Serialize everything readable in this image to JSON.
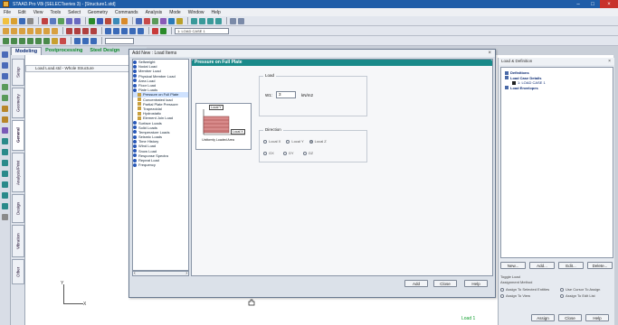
{
  "title_bar": {
    "text": "STAAD.Pro V8i (SELECTseries 3) - [Structure1.std]",
    "controls": [
      "–",
      "□",
      "×"
    ]
  },
  "menu": [
    "File",
    "Edit",
    "View",
    "Tools",
    "Select",
    "Geometry",
    "Commands",
    "Analysis",
    "Mode",
    "Window",
    "Help"
  ],
  "toolbar": {
    "combo1": "1: LOAD CASE 1",
    "combo2": ""
  },
  "page_tabs": {
    "modeling": "Modeling",
    "postprocessing": "Postprocessing",
    "steel_design": "Steel Design"
  },
  "side_tabs": [
    "Setup",
    "Geometry",
    "General",
    "Analysis/Print",
    "Design",
    "Vibration",
    "Other"
  ],
  "view_title": "Load Load.std - Whole Structure",
  "dialog": {
    "title": "Add New : Load Items",
    "panel_header": "Pressure on Full Plate",
    "tree": [
      {
        "label": "Selfweight",
        "kind": "load"
      },
      {
        "label": "Nodal Load",
        "kind": "load"
      },
      {
        "label": "Member Load",
        "kind": "load"
      },
      {
        "label": "Physical Member Load",
        "kind": "load"
      },
      {
        "label": "Area Load",
        "kind": "load"
      },
      {
        "label": "Floor Load",
        "kind": "load"
      },
      {
        "label": "Plate Loads",
        "kind": "load"
      },
      {
        "label": "Pressure on Full Plate",
        "kind": "sub",
        "selected": true
      },
      {
        "label": "Concentrated load",
        "kind": "sub"
      },
      {
        "label": "Partial Plate Pressure",
        "kind": "sub"
      },
      {
        "label": "Trapezoidal",
        "kind": "sub"
      },
      {
        "label": "Hydrostatic",
        "kind": "sub"
      },
      {
        "label": "Element Join Load",
        "kind": "sub"
      },
      {
        "label": "Surface Loads",
        "kind": "load"
      },
      {
        "label": "Solid Loads",
        "kind": "load"
      },
      {
        "label": "Temperature Loads",
        "kind": "load"
      },
      {
        "label": "Seismic Loads",
        "kind": "load"
      },
      {
        "label": "Time History",
        "kind": "load"
      },
      {
        "label": "Wind Load",
        "kind": "load"
      },
      {
        "label": "Snow Load",
        "kind": "load"
      },
      {
        "label": "Response Spectra",
        "kind": "load"
      },
      {
        "label": "Repeat Load",
        "kind": "load"
      },
      {
        "label": "Frequency",
        "kind": "load"
      }
    ],
    "figure": {
      "top_label": "Local Y",
      "right_label": "Local X",
      "caption": "Uniformly Loaded Area"
    },
    "load": {
      "group_label": "Load",
      "w_label": "W1:",
      "w_value": "3",
      "w_unit": "kN/m2"
    },
    "direction": {
      "group_label": "Direction",
      "options_row1": [
        {
          "label": "Local X",
          "checked": false
        },
        {
          "label": "Local Y",
          "checked": false
        },
        {
          "label": "Local Z",
          "checked": true
        }
      ],
      "options_row2": [
        {
          "label": "GX",
          "checked": false
        },
        {
          "label": "GY",
          "checked": false
        },
        {
          "label": "GZ",
          "checked": false
        }
      ]
    },
    "buttons": {
      "add": "Add",
      "close": "Close",
      "help": "Help"
    }
  },
  "right_panel": {
    "header": "Load & Definition",
    "tree": [
      {
        "label": "Definitions",
        "bold": true
      },
      {
        "label": "Load Case Details",
        "bold": true
      },
      {
        "label": "1: LOAD CASE 1",
        "bold": false,
        "indent": true
      },
      {
        "label": "Load Envelopes",
        "bold": true
      }
    ],
    "buttons": {
      "new": "New...",
      "add": "Add...",
      "edit": "Edit...",
      "delete": "Delete..."
    },
    "toggles": [
      "Toggle Load",
      "Assignment Method",
      "Assign To Selected Entities",
      "Use Cursor To Assign",
      "Assign To View",
      "Assign To Edit List"
    ],
    "bottom_buttons": {
      "assign": "Assign",
      "close": "Close",
      "help": "Help"
    }
  },
  "status_bar": "Load 1",
  "axis": {
    "y": "Y",
    "x": "X"
  },
  "colors": {
    "title_bg": "#1f5da8",
    "panel_header": "#1a8a8a",
    "status_text": "#12a030"
  }
}
